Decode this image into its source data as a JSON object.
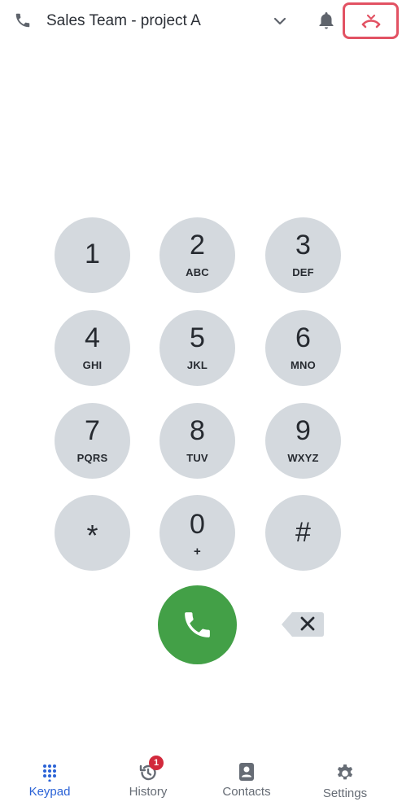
{
  "header": {
    "title": "Sales Team - project A",
    "icons": [
      "phone-icon",
      "chevron-down-icon",
      "bell-icon",
      "hangup-icon"
    ],
    "hangup_color": "#e25263"
  },
  "keypad": {
    "keys": [
      {
        "digit": "1",
        "letters": ""
      },
      {
        "digit": "2",
        "letters": "ABC"
      },
      {
        "digit": "3",
        "letters": "DEF"
      },
      {
        "digit": "4",
        "letters": "GHI"
      },
      {
        "digit": "5",
        "letters": "JKL"
      },
      {
        "digit": "6",
        "letters": "MNO"
      },
      {
        "digit": "7",
        "letters": "PQRS"
      },
      {
        "digit": "8",
        "letters": "TUV"
      },
      {
        "digit": "9",
        "letters": "WXYZ"
      },
      {
        "digit": "*",
        "letters": ""
      },
      {
        "digit": "0",
        "letters": "+"
      },
      {
        "digit": "#",
        "letters": ""
      }
    ],
    "key_color": "#d4d9de",
    "call_color": "#43a047"
  },
  "nav": {
    "items": [
      {
        "label": "Keypad",
        "icon": "keypad-icon",
        "active": true
      },
      {
        "label": "History",
        "icon": "history-icon",
        "badge": "1"
      },
      {
        "label": "Contacts",
        "icon": "contacts-icon"
      },
      {
        "label": "Settings",
        "icon": "gear-icon"
      }
    ],
    "active_color": "#2a62d6",
    "badge_color": "#d2293c"
  }
}
